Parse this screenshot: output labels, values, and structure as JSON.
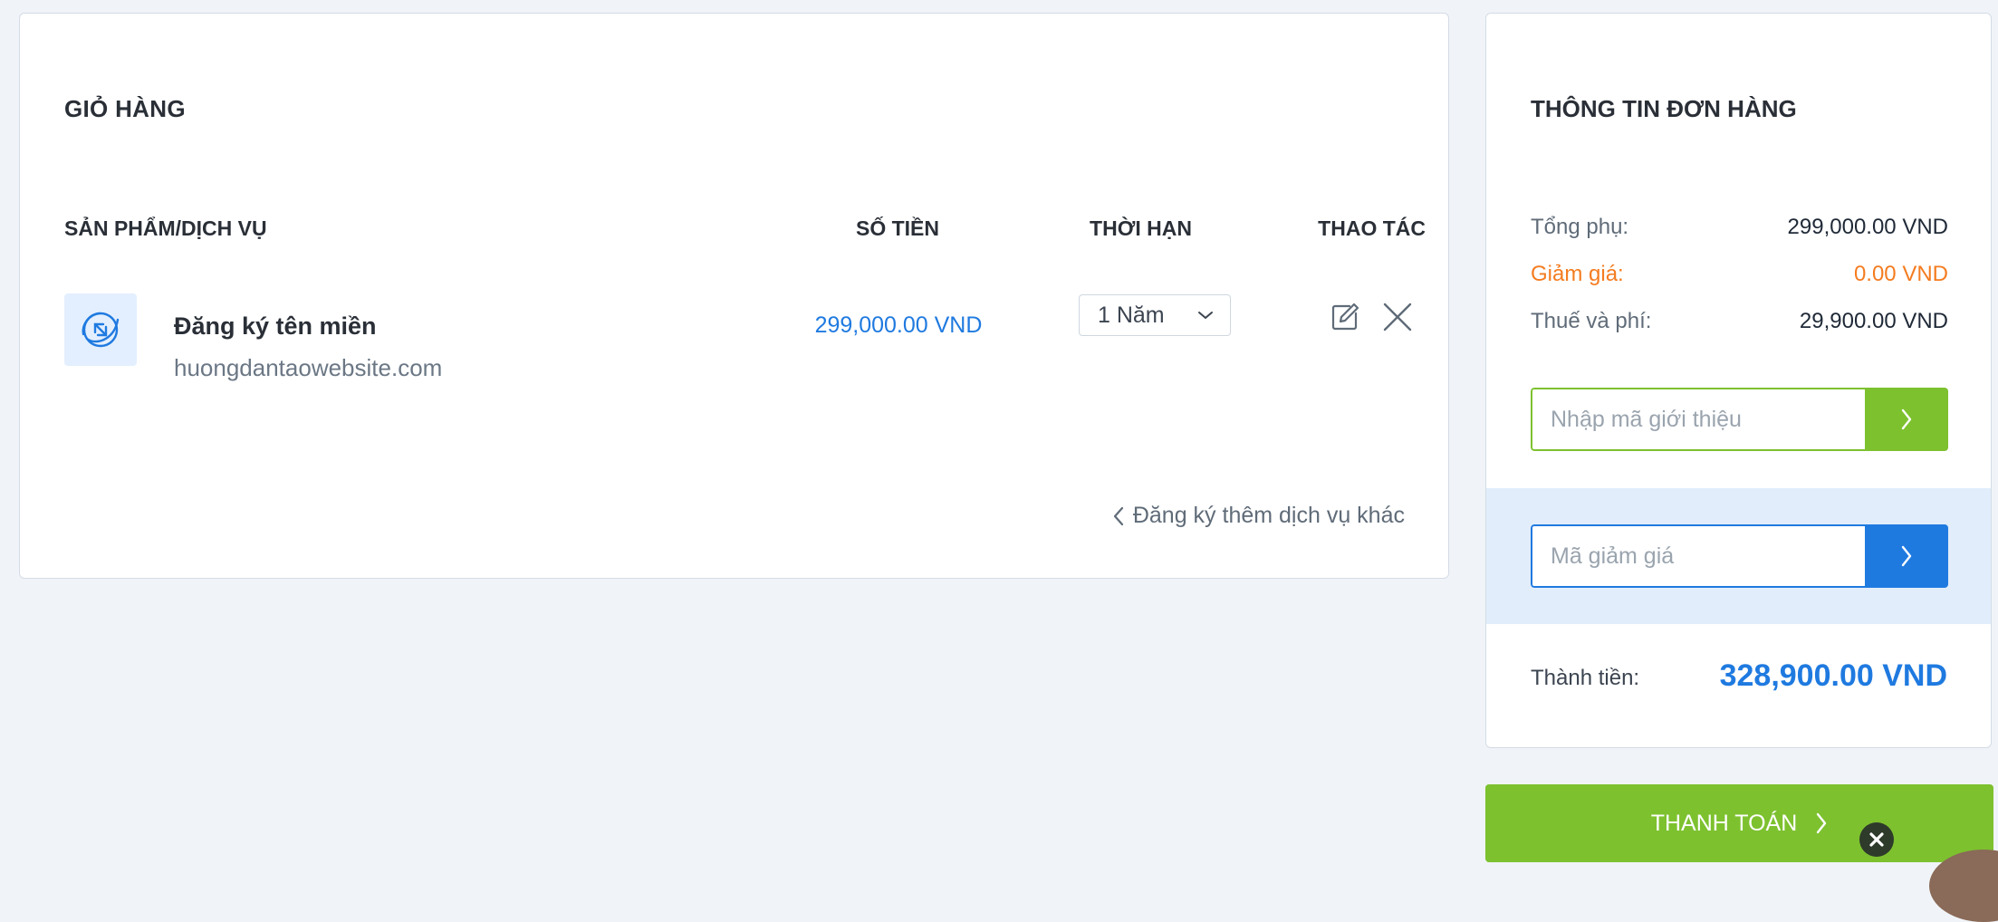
{
  "cart": {
    "title": "GIỎ HÀNG",
    "columns": {
      "product": "SẢN PHẨM/DỊCH VỤ",
      "price": "SỐ TIỀN",
      "term": "THỜI HẠN",
      "action": "THAO TÁC"
    },
    "items": [
      {
        "name": "Đăng ký tên miền",
        "domain": "huongdantaowebsite.com",
        "price": "299,000.00 VND",
        "term": "1 Năm",
        "icon": "domain-globe-icon"
      }
    ],
    "more_services": "Đăng ký thêm dịch vụ khác"
  },
  "order": {
    "title": "THÔNG TIN ĐƠN HÀNG",
    "subtotal_label": "Tổng phụ:",
    "subtotal_value": "299,000.00 VND",
    "discount_label": "Giảm giá:",
    "discount_value": "0.00 VND",
    "tax_label": "Thuế và phí:",
    "tax_value": "29,900.00 VND",
    "referral_placeholder": "Nhập mã giới thiệu",
    "promo_placeholder": "Mã giảm giá",
    "total_label": "Thành tiền:",
    "total_value": "328,900.00 VND"
  },
  "checkout": {
    "label": "THANH TOÁN"
  },
  "colors": {
    "accent_blue": "#1f7ae0",
    "accent_green": "#7dc12f",
    "discount_orange": "#f47c20"
  }
}
